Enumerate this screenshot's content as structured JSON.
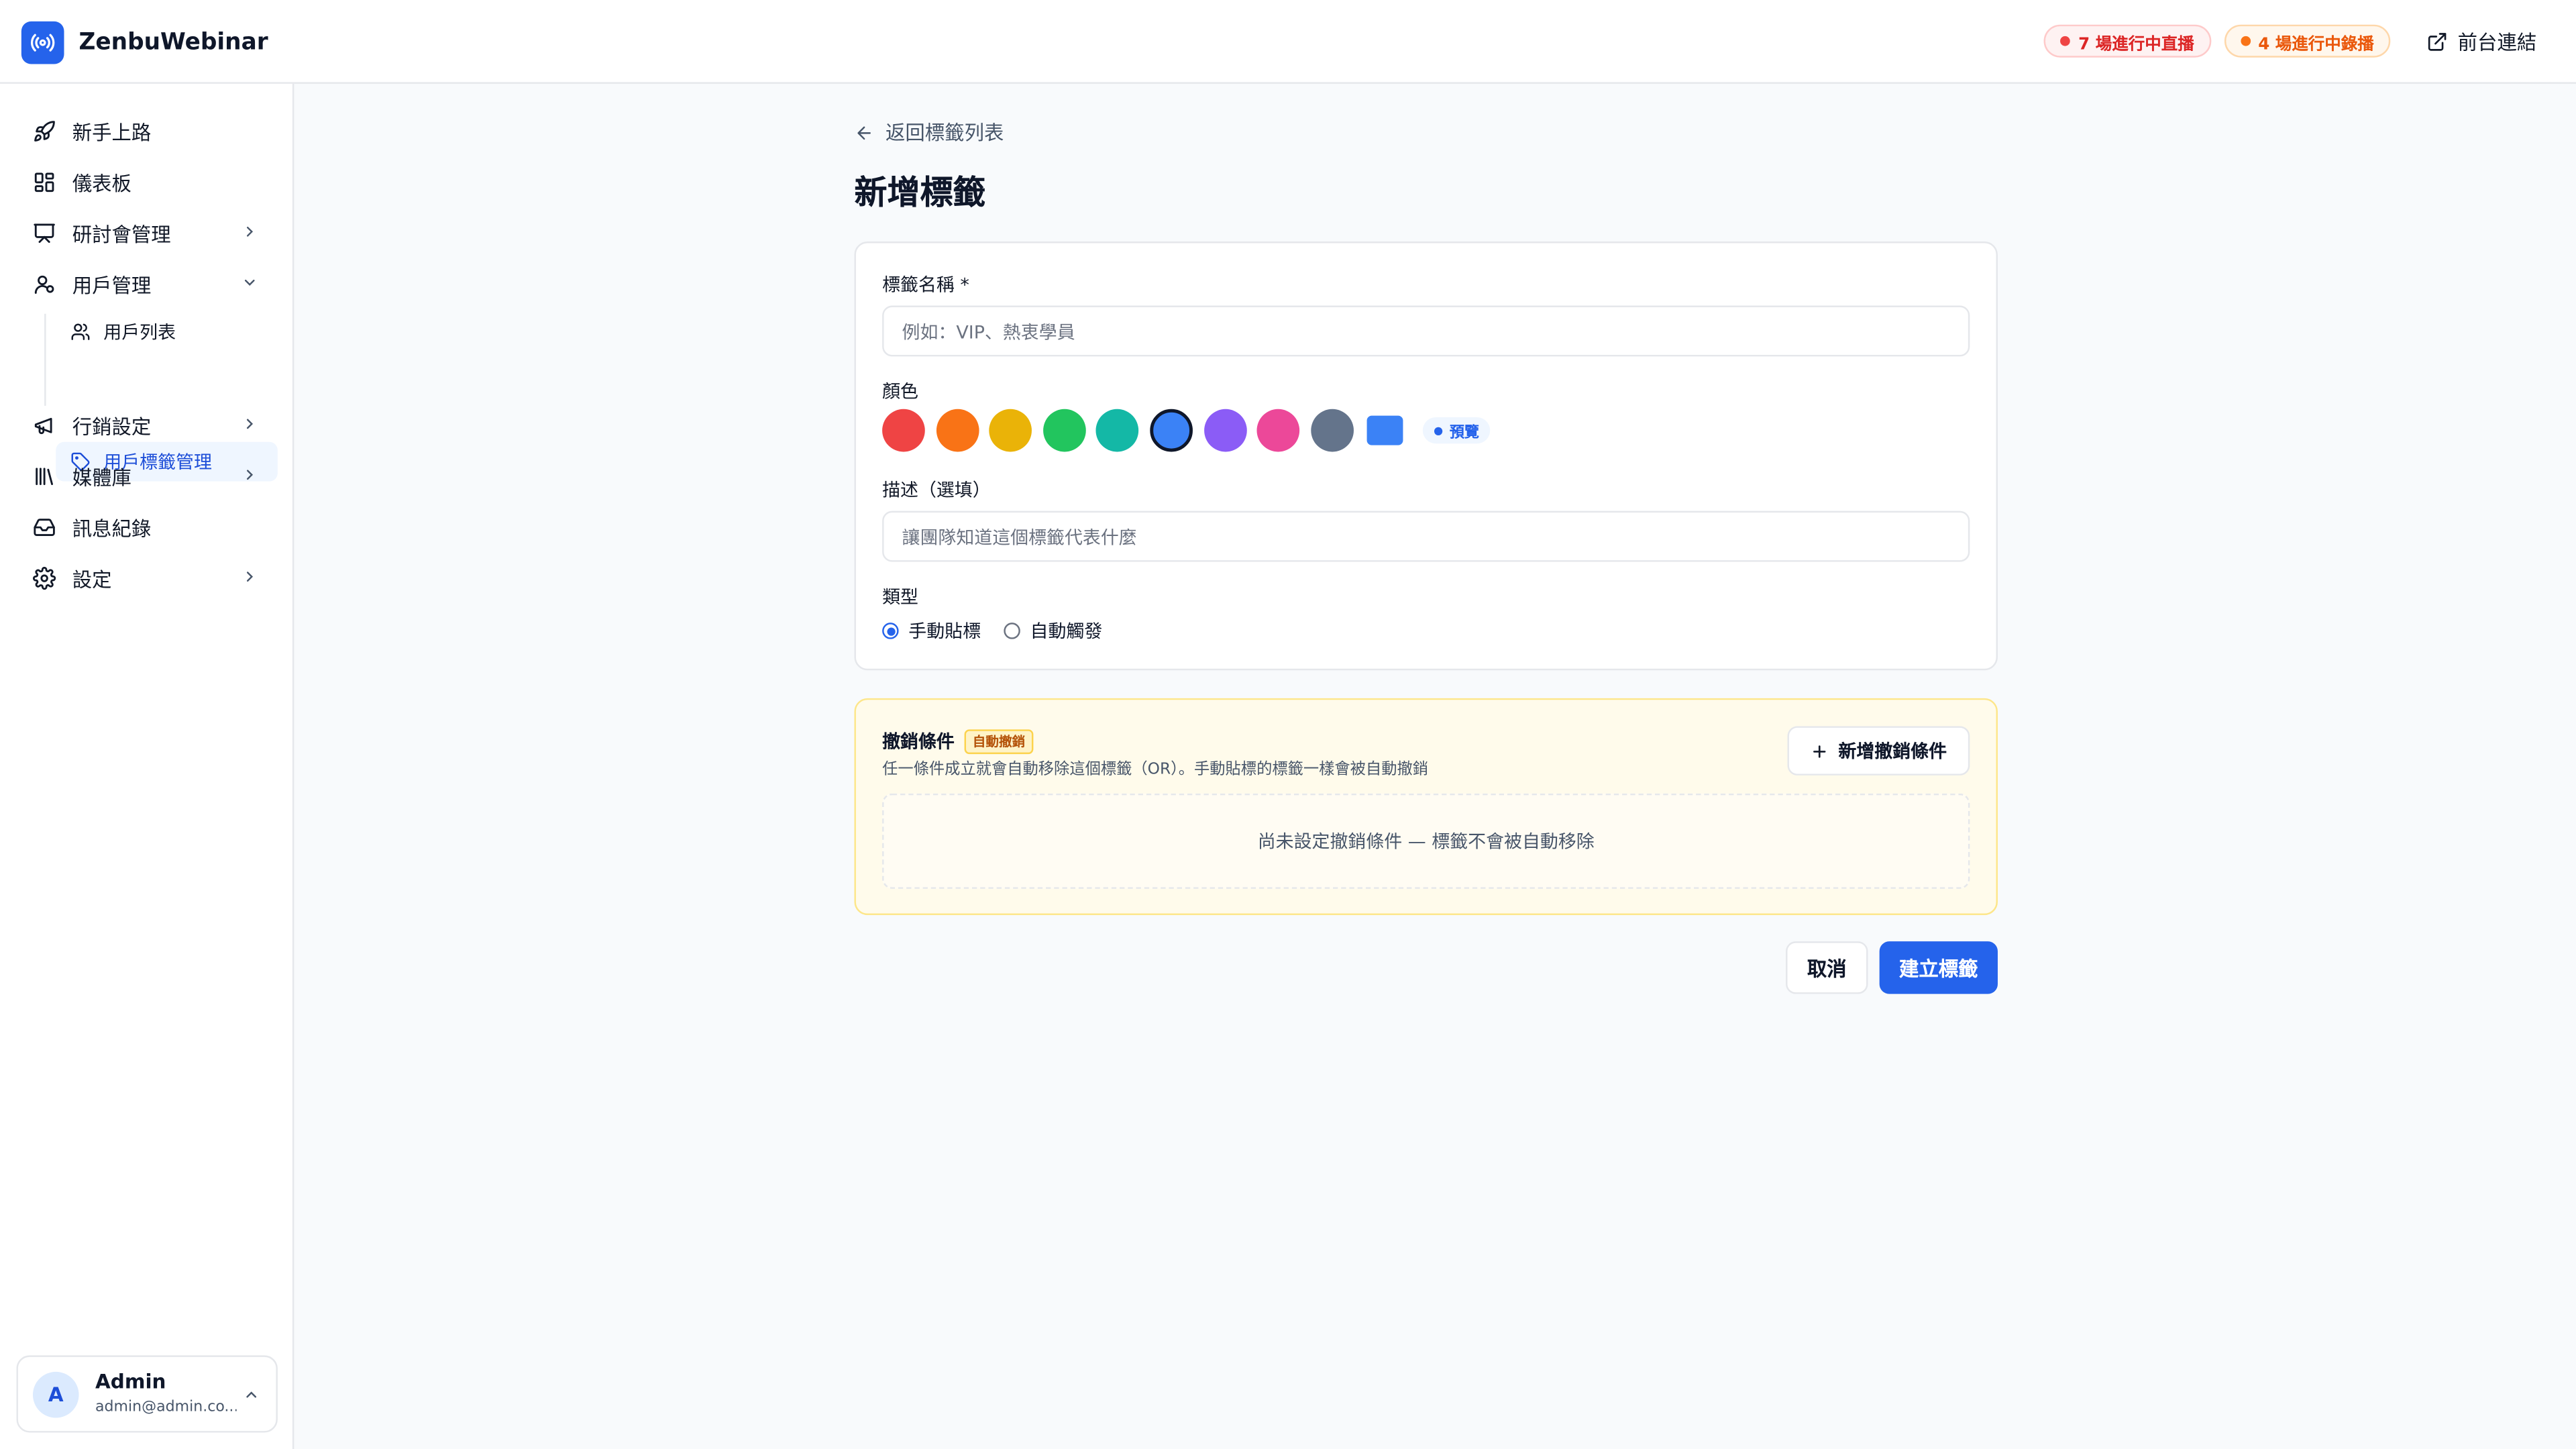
{
  "app": {
    "name": "ZenbuWebinar"
  },
  "header": {
    "live_badge": "7 場進行中直播",
    "recording_badge": "4 場進行中錄播",
    "front_link": "前台連結"
  },
  "sidebar": {
    "items": [
      {
        "label": "新手上路",
        "icon": "rocket-icon"
      },
      {
        "label": "儀表板",
        "icon": "dashboard-icon"
      },
      {
        "label": "研討會管理",
        "icon": "presentation-icon"
      },
      {
        "label": "用戶管理",
        "icon": "user-icon"
      },
      {
        "label": "行銷設定",
        "icon": "megaphone-icon"
      },
      {
        "label": "媒體庫",
        "icon": "library-icon"
      },
      {
        "label": "訊息紀錄",
        "icon": "inbox-icon"
      },
      {
        "label": "設定",
        "icon": "gear-icon"
      }
    ],
    "sub_items": [
      {
        "label": "用戶列表",
        "icon": "users-icon"
      },
      {
        "label": "用戶標籤管理",
        "icon": "tag-icon"
      }
    ]
  },
  "user": {
    "initial": "A",
    "name": "Admin",
    "email": "admin@admin.co..."
  },
  "page": {
    "back": "返回標籤列表",
    "title": "新增標籤"
  },
  "form": {
    "name_label": "標籤名稱 *",
    "name_placeholder": "例如：VIP、熱衷學員",
    "color_label": "顏色",
    "colors": [
      "#ef4444",
      "#f97316",
      "#eab308",
      "#22c55e",
      "#14b8a6",
      "#3b82f6",
      "#8b5cf6",
      "#ec4899",
      "#64748b"
    ],
    "selected_color": "#3b82f6",
    "preview_label": "預覽",
    "desc_label": "描述（選填）",
    "desc_placeholder": "讓團隊知道這個標籤代表什麼",
    "type_label": "類型",
    "type_manual": "手動貼標",
    "type_auto": "自動觸發",
    "selected_type": "手動貼標"
  },
  "revoke": {
    "title": "撤銷條件",
    "badge": "自動撤銷",
    "desc": "任一條件成立就會自動移除這個標籤（OR）。手動貼標的標籤一樣會被自動撤銷",
    "add_button": "新增撤銷條件",
    "empty": "尚未設定撤銷條件 — 標籤不會被自動移除"
  },
  "actions": {
    "cancel": "取消",
    "create": "建立標籤"
  }
}
